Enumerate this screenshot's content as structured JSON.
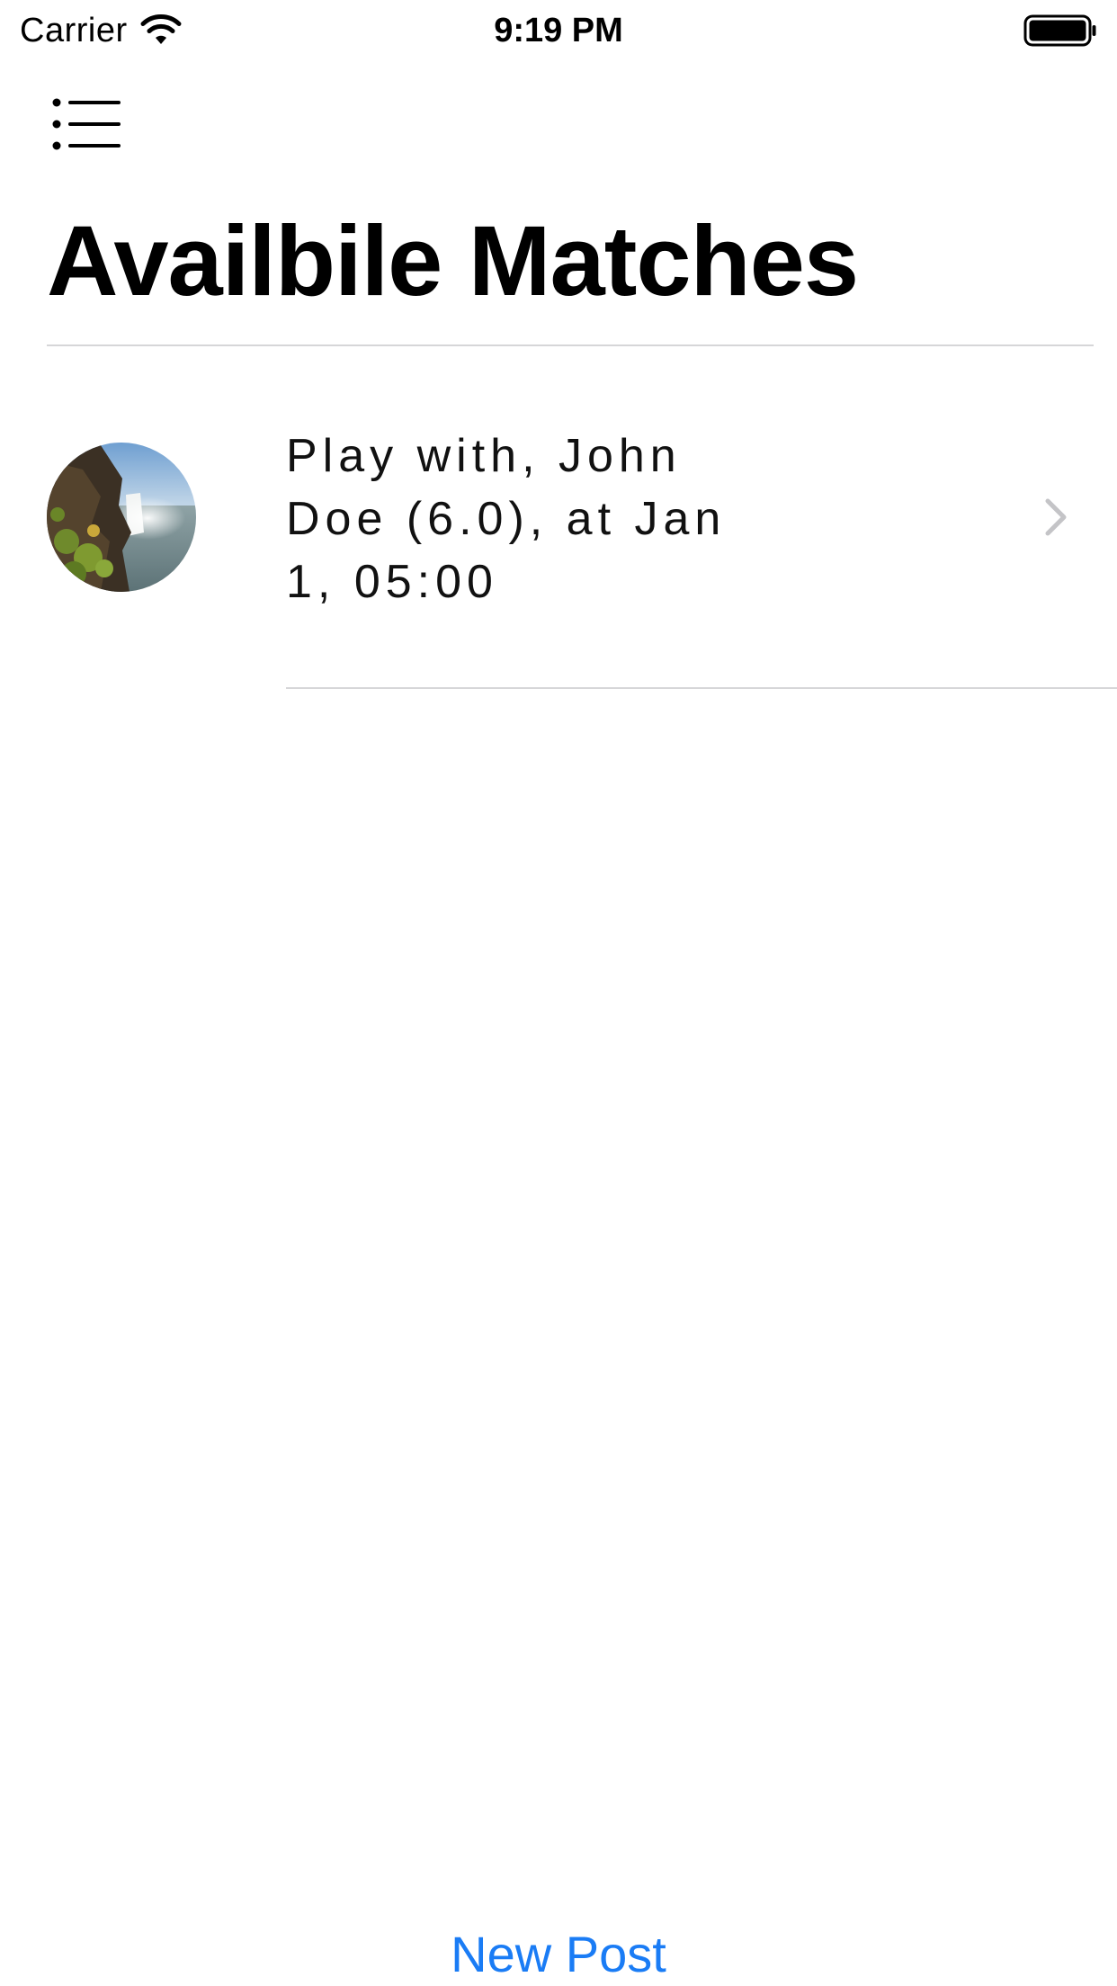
{
  "status_bar": {
    "carrier": "Carrier",
    "time": "9:19 PM",
    "wifi_icon": "wifi-icon",
    "battery_icon": "battery-full-icon",
    "battery_level": 1.0
  },
  "nav": {
    "menu_icon": "list-bullet-icon"
  },
  "page": {
    "title": "Availbile Matches"
  },
  "matches": [
    {
      "text": "Play with, John Doe (6.0), at Jan 1, 05:00",
      "avatar": "waterfall-landscape-photo",
      "accessory_icon": "chevron-right-icon"
    }
  ],
  "actions": {
    "new_post_label": "New Post"
  },
  "colors": {
    "accent": "#1a7cf5",
    "separator": "#d6d6d8",
    "chevron": "#c4c4c7",
    "background": "#ffffff"
  }
}
